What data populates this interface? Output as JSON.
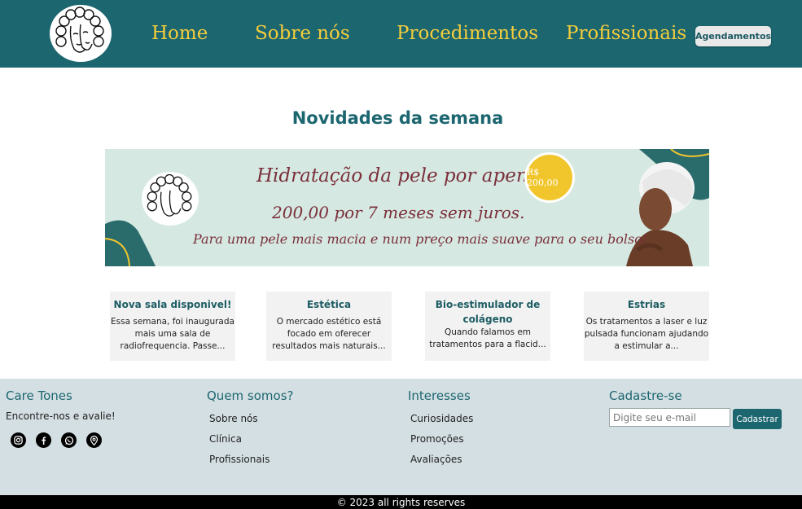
{
  "header": {
    "logo_icon": "curly-hair-woman-logo-icon",
    "nav": [
      {
        "label": "Home"
      },
      {
        "label": "Sobre nós"
      },
      {
        "label": "Procedimentos"
      },
      {
        "label": "Profissionais"
      }
    ],
    "cta_label": "Agendamentos"
  },
  "main": {
    "title": "Novidades da semana",
    "banner": {
      "line1": "Hidratação da pele por apenas",
      "line2": "200,00 por 7 meses sem juros.",
      "line3": "Para uma pele mais macia e num preço mais suave para o seu bolso!",
      "price_badge": "R$ 200,00"
    },
    "cards": [
      {
        "title": "Nova sala disponivel!",
        "text": "Essa semana, foi inaugurada mais uma sala de radiofrequencia.  Passe..."
      },
      {
        "title": "Estética",
        "text": "O mercado estético está focado em oferecer resultados mais naturais..."
      },
      {
        "title": "Bio-estimulador de colágeno",
        "text": "Quando falamos em tratamentos para a flacid..."
      },
      {
        "title": "Estrias",
        "text": "Os tratamentos a laser e luz pulsada funcionam ajudando a estimular a..."
      }
    ]
  },
  "footer": {
    "brand": "Care Tones",
    "brand_sub": "Encontre-nos e avalie!",
    "socials": [
      "instagram-icon",
      "facebook-icon",
      "whatsapp-icon",
      "location-pin-icon"
    ],
    "col2": {
      "title": "Quem somos?",
      "links": [
        "Sobre nós",
        "Clínica",
        "Profissionais"
      ]
    },
    "col3": {
      "title": "Interesses",
      "links": [
        "Curiosidades",
        "Promoções",
        "Avaliações"
      ]
    },
    "col4": {
      "title": "Cadastre-se",
      "email_placeholder": "Digite seu e-mail",
      "button_label": "Cadastrar"
    }
  },
  "copyright": "© 2023 all rights reserves",
  "colors": {
    "header_bg": "#1c6670",
    "nav_text": "#f4cd3b",
    "accent": "#1c6670",
    "banner_bg": "#d5e8e2",
    "banner_text": "#7b2f3a",
    "badge": "#f1c62d",
    "footer_bg": "#d4dfe3"
  }
}
